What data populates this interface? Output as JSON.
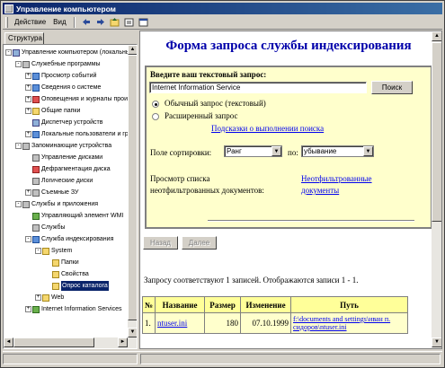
{
  "window": {
    "title": "Управление компьютером"
  },
  "menu": {
    "items": [
      "Действие",
      "Вид"
    ]
  },
  "toolbar": {
    "buttons": [
      "back-icon",
      "forward-icon",
      "up-icon",
      "properties-icon",
      "view-icon"
    ]
  },
  "left_pane": {
    "tab": "Структура"
  },
  "tree": [
    {
      "label": "Управление компьютером (локальным",
      "icon": "computer-icon",
      "indent": 0,
      "expander": "-"
    },
    {
      "label": "Служебные программы",
      "icon": "tool-icon",
      "indent": 1,
      "expander": "-"
    },
    {
      "label": "Просмотр событий",
      "icon": "event-viewer-icon",
      "indent": 2,
      "expander": "+"
    },
    {
      "label": "Сведения о системе",
      "icon": "system-info-icon",
      "indent": 2,
      "expander": "+"
    },
    {
      "label": "Оповещения и журналы произ",
      "icon": "alerts-icon",
      "indent": 2,
      "expander": "+"
    },
    {
      "label": "Общие папки",
      "icon": "shared-folders-icon",
      "indent": 2,
      "expander": "+"
    },
    {
      "label": "Диспетчер устройств",
      "icon": "device-manager-icon",
      "indent": 2,
      "expander": ""
    },
    {
      "label": "Локальные пользователи и гру",
      "icon": "users-icon",
      "indent": 2,
      "expander": "+"
    },
    {
      "label": "Запоминающие устройства",
      "icon": "storage-icon",
      "indent": 1,
      "expander": "-"
    },
    {
      "label": "Управление дисками",
      "icon": "disk-management-icon",
      "indent": 2,
      "expander": ""
    },
    {
      "label": "Дефрагментация диска",
      "icon": "defrag-icon",
      "indent": 2,
      "expander": ""
    },
    {
      "label": "Логические диски",
      "icon": "logical-drives-icon",
      "indent": 2,
      "expander": ""
    },
    {
      "label": "Съемные ЗУ",
      "icon": "removable-storage-icon",
      "indent": 2,
      "expander": "+"
    },
    {
      "label": "Службы и приложения",
      "icon": "services-apps-icon",
      "indent": 1,
      "expander": "-"
    },
    {
      "label": "Управляющий элемент WMI",
      "icon": "wmi-icon",
      "indent": 2,
      "expander": ""
    },
    {
      "label": "Службы",
      "icon": "services-icon",
      "indent": 2,
      "expander": ""
    },
    {
      "label": "Служба индексирования",
      "icon": "indexing-service-icon",
      "indent": 2,
      "expander": "-"
    },
    {
      "label": "System",
      "icon": "catalog-icon",
      "indent": 3,
      "expander": "-"
    },
    {
      "label": "Папки",
      "icon": "folder-icon",
      "indent": 4,
      "expander": ""
    },
    {
      "label": "Свойства",
      "icon": "folder-icon",
      "indent": 4,
      "expander": ""
    },
    {
      "label": "Опрос каталога",
      "icon": "folder-icon",
      "indent": 4,
      "expander": "",
      "selected": true
    },
    {
      "label": "Web",
      "icon": "catalog-icon",
      "indent": 3,
      "expander": "+"
    },
    {
      "label": "Internet Information Services",
      "icon": "iis-icon",
      "indent": 2,
      "expander": "+"
    }
  ],
  "query_page": {
    "title": "Форма запроса службы индексирования",
    "prompt": "Введите ваш текстовый запрос:",
    "query_value": "Internet Information Service",
    "search_button": "Поиск",
    "radio_simple": "Обычный запрос (текстовый)",
    "radio_advanced": "Расширенный запрос",
    "hints_link": "Подсказки о выполнении поиска",
    "sort_label": "Поле сортировки:",
    "sort_field": "Ранг",
    "order_label": "по:",
    "order_value": "убывание",
    "unfiltered_label_1": "Просмотр списка",
    "unfiltered_label_2": "неотфильтрованных документов:",
    "unfiltered_link_1": "Неотфильтрованные",
    "unfiltered_link_2": "документы",
    "back_button": "Назад",
    "next_button": "Далее",
    "summary": "Запросу соответствуют 1 записей. Отображаются записи 1 - 1."
  },
  "results": {
    "headers": [
      "№",
      "Название",
      "Размер",
      "Изменение",
      "Путь"
    ],
    "rows": [
      [
        "1.",
        "ntuser.ini",
        "180",
        "07.10.1999",
        "f:\\documents and settings\\иван п. сидоров\\ntuser.ini"
      ]
    ]
  }
}
